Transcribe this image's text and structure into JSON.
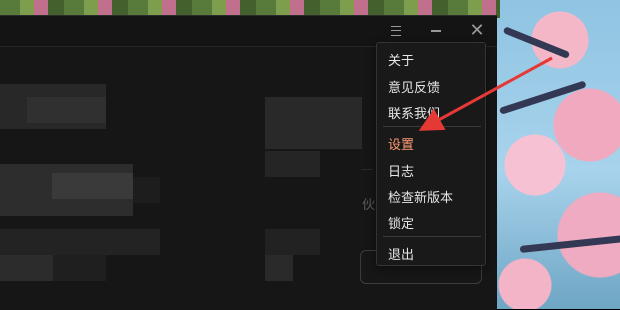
{
  "window": {
    "controls": {
      "menu_icon": "menu-icon",
      "minimize_icon": "minimize-icon",
      "close_icon": "close-icon"
    }
  },
  "content": {
    "partial_text": "伙"
  },
  "dropdown_menu": {
    "items": [
      {
        "label": "关于",
        "highlighted": false
      },
      {
        "label": "意见反馈",
        "highlighted": false
      },
      {
        "label": "联系我们",
        "highlighted": false
      },
      {
        "label": "设置",
        "highlighted": true
      },
      {
        "label": "日志",
        "highlighted": false
      },
      {
        "label": "检查新版本",
        "highlighted": false
      },
      {
        "label": "锁定",
        "highlighted": false
      },
      {
        "label": "退出",
        "highlighted": false
      }
    ]
  },
  "annotation": {
    "arrow_color": "#e53935",
    "points_to": "设置"
  },
  "colors": {
    "highlight_text": "#ff9b73",
    "menu_bg": "#191919",
    "app_bg": "#161616"
  }
}
